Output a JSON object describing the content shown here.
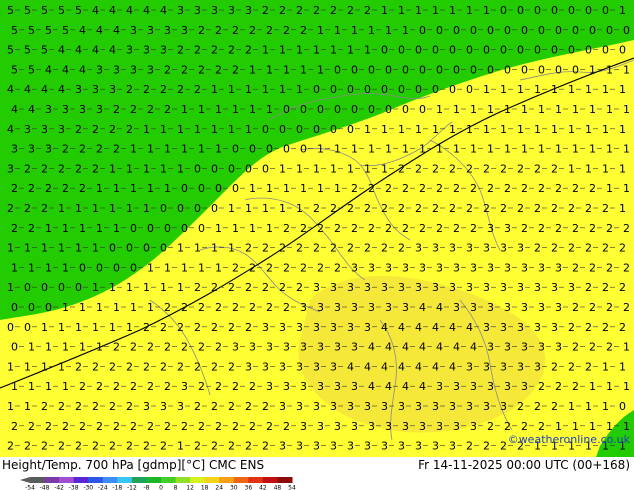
{
  "map": {
    "fields": {
      "warm_color": "#ffff33",
      "cold_color": "#22cc00",
      "core_color": "#f2e23a",
      "line_color": "#000000",
      "contour_color": "#666666"
    },
    "grid_rows": [
      "5 5 5 5 5 4 4 4 4 4 3 3 3 3 3 2 2 2 2 2 2 2 1 1 1 1 1 1 1 0 0 0 0 0 0 0 1",
      "5 5 5 5 4 4 4 3 3 3 3 2 2 2 2 2 2 2 1 1 1 1 1 1 0 0 0 0 0 0 0 0 0 0 0 0 0",
      "5 5 5 4 4 4 4 3 3 3 2 2 2 2 2 1 1 1 1 1 1 1 0 0 0 0 0 0 0 0 0 0 0 0 0 0 0",
      "5 5 4 4 4 3 3 3 3 2 2 2 2 2 1 1 1 1 1 0 0 0 0 0 0 0 0 0 0 0 0 0 0 0 1 1 1",
      "4 4 4 4 3 3 3 2 2 2 2 2 1 1 1 1 1 1 0 0 0 0 0 0 0 0 0 0 1 1 1 1 1 1 1 1 1",
      "4 4 3 3 3 3 2 2 2 2 1 1 1 1 1 1 0 0 0 0 0 0 0 0 0 1 1 1 1 1 1 1 1 1 1 1 1",
      "4 3 3 3 2 2 2 2 1 1 1 1 1 1 1 0 0 0 0 0 0 1 1 1 1 1 1 1 1 1 1 1 1 1 1 1 1",
      "3 3 3 2 2 2 2 1 1 1 1 1 1 0 0 0 0 0 1 1 1 1 1 1 1 1 1 1 1 1 1 1 1 1 1 1 1",
      "3 2 2 2 2 2 1 1 1 1 1 0 0 0 0 0 1 1 1 1 1 1 1 2 2 2 2 2 2 2 2 2 2 1 1 1 1",
      "2 2 2 2 2 1 1 1 1 1 0 0 0 0 1 1 1 1 1 1 2 2 2 2 2 2 2 2 2 2 2 2 2 2 2 1 1",
      "2 2 2 1 1 1 1 1 1 0 0 0 0 1 1 1 1 1 2 2 2 2 2 2 2 2 2 2 2 2 2 2 2 2 2 2 1",
      "2 2 1 1 1 1 1 0 0 0 0 0 1 1 1 1 2 2 2 2 2 2 2 2 2 2 2 2 3 3 2 2 2 2 2 2 2",
      "1 1 1 1 1 1 0 0 0 0 1 1 1 1 2 2 2 2 2 2 2 2 2 2 3 3 3 3 3 3 3 2 2 2 2 2 2",
      "1 1 1 1 0 0 0 0 1 1 1 1 1 2 2 2 2 2 2 2 3 3 3 3 3 3 3 3 3 3 3 3 3 2 2 2 2",
      "1 0 0 0 0 1 1 1 1 1 1 2 2 2 2 2 2 2 3 3 3 3 3 3 3 3 3 3 3 3 3 3 3 3 2 2 2",
      "0 0 0 1 1 1 1 1 1 2 2 2 2 2 2 2 2 3 3 3 3 3 3 3 4 4 3 3 3 3 3 3 3 2 2 2 2",
      "0 0 1 1 1 1 1 1 2 2 2 2 2 2 2 3 3 3 3 3 3 3 4 4 4 4 4 4 3 3 3 3 3 2 2 2 2",
      "0 1 1 1 1 1 2 2 2 2 2 2 2 3 3 3 3 3 3 3 3 4 4 4 4 4 4 4 3 3 3 3 3 2 2 2 1",
      "1 1 1 1 2 2 2 2 2 2 2 2 2 2 3 3 3 3 3 3 4 4 4 4 4 4 4 3 3 3 3 3 2 2 2 1 1",
      "1 1 1 1 2 2 2 2 2 2 3 2 2 2 2 3 3 3 3 3 3 4 4 4 4 3 3 3 3 3 3 2 2 2 1 1 1",
      "1 1 2 2 2 2 2 2 3 3 3 2 2 2 2 2 3 3 3 3 3 3 3 3 3 3 3 3 3 3 2 2 2 1 1 1 0",
      "2 2 2 2 2 2 2 2 2 2 2 2 2 2 2 2 2 3 3 3 3 3 3 3 3 3 3 3 2 2 2 2 1 1 1 1 1",
      "2 2 2 2 2 2 2 2 2 2 1 2 2 2 2 2 3 3 3 3 3 3 3 3 3 3 3 2 2 2 2 1 1 1 1 1 1"
    ]
  },
  "footer": {
    "title": "Height/Temp. 700 hPa [gdmp][°C] CMC ENS",
    "datetime": "Fr 14-11-2025 00:00 UTC (00+168)",
    "credit": "©weatheronline.co.uk"
  },
  "legend": {
    "labels": [
      "-54",
      "-48",
      "-42",
      "-38",
      "-30",
      "-24",
      "-18",
      "-12",
      "-8",
      "0",
      "8",
      "12",
      "18",
      "24",
      "30",
      "36",
      "42",
      "48",
      "54"
    ],
    "colors": [
      "#5b5b5b",
      "#7a3aa8",
      "#a24dd4",
      "#5a27d6",
      "#2f56e8",
      "#3c8ef2",
      "#36c6f4",
      "#1fa35a",
      "#18b82a",
      "#43cf26",
      "#8fe026",
      "#d8f01e",
      "#f3d41a",
      "#f5a015",
      "#ef6612",
      "#e23310",
      "#c10f0f",
      "#8e0b0b"
    ]
  }
}
